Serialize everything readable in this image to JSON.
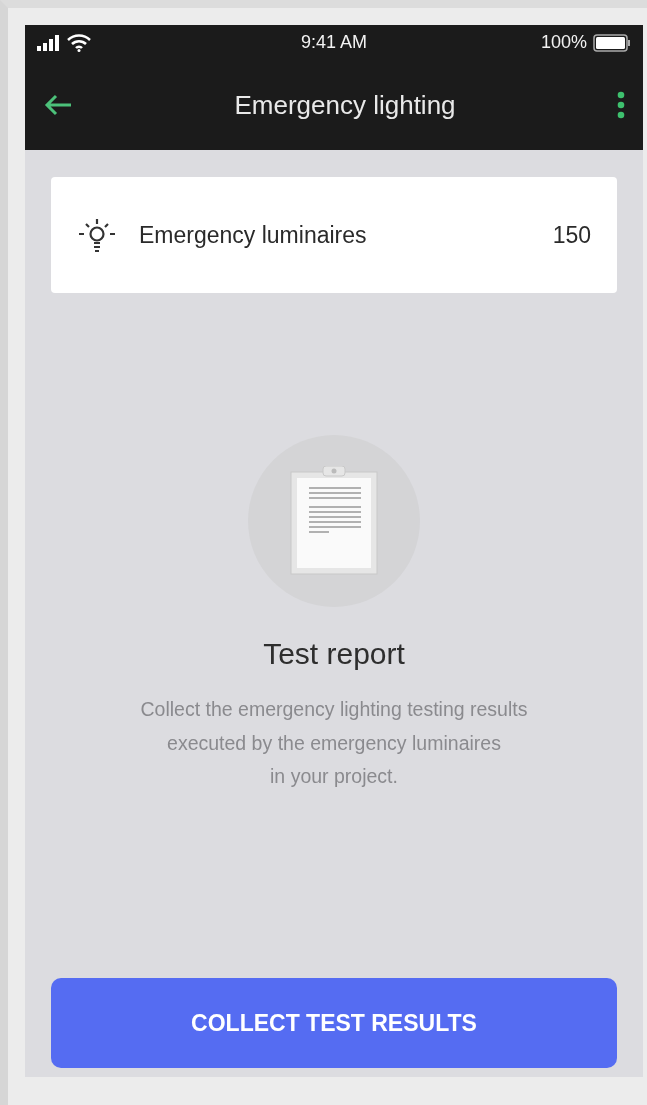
{
  "status_bar": {
    "time": "9:41 AM",
    "battery": "100%"
  },
  "header": {
    "title": "Emergency lighting"
  },
  "summary": {
    "label": "Emergency luminaires",
    "count": "150"
  },
  "empty_state": {
    "title": "Test report",
    "description_lines": [
      "Collect the emergency lighting testing results",
      "executed by the emergency luminaires",
      "in your project."
    ]
  },
  "action": {
    "label": "COLLECT TEST RESULTS"
  }
}
